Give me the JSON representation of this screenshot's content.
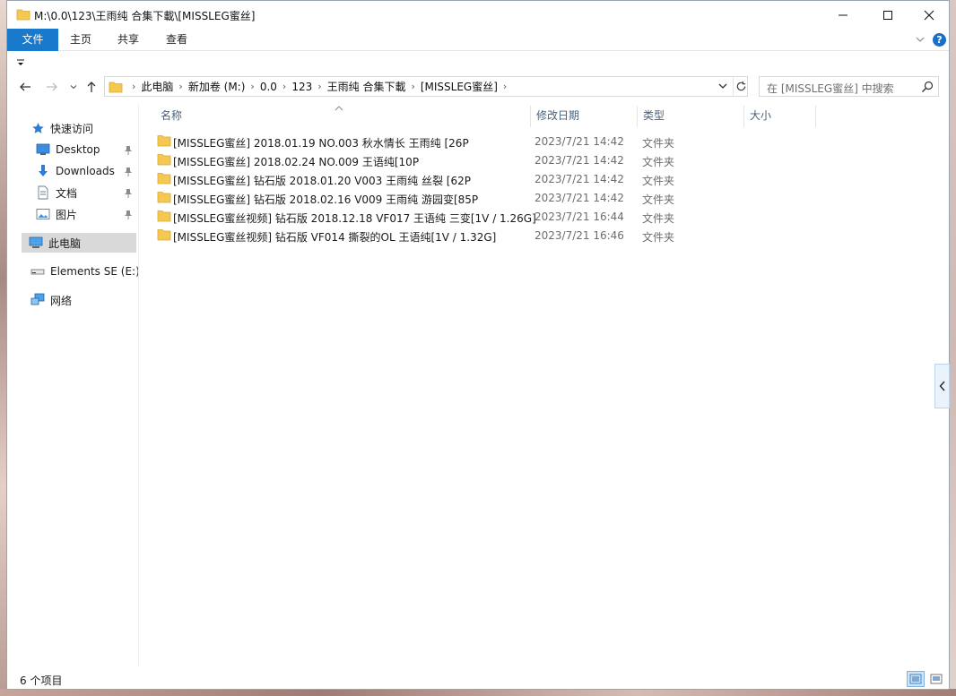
{
  "window": {
    "title": "M:\\0.0\\123\\王雨纯 合集下載\\[MISSLEG蜜丝]"
  },
  "ribbon": {
    "tabs": [
      {
        "label": "文件"
      },
      {
        "label": "主页"
      },
      {
        "label": "共享"
      },
      {
        "label": "查看"
      }
    ],
    "help_label": "?"
  },
  "address": {
    "crumbs": [
      "此电脑",
      "新加卷 (M:)",
      "0.0",
      "123",
      "王雨纯 合集下載",
      "[MISSLEG蜜丝]"
    ]
  },
  "search": {
    "placeholder": "在 [MISSLEG蜜丝] 中搜索"
  },
  "nav": {
    "quick_access": "快速访问",
    "items": [
      {
        "label": "Desktop"
      },
      {
        "label": "Downloads"
      },
      {
        "label": "文档"
      },
      {
        "label": "图片"
      }
    ],
    "this_pc": "此电脑",
    "drive": "Elements SE (E:)",
    "network": "网络"
  },
  "columns": {
    "name": "名称",
    "date": "修改日期",
    "type": "类型",
    "size": "大小"
  },
  "files": [
    {
      "name": "[MISSLEG蜜丝] 2018.01.19 NO.003 秋水情长 王雨纯 [26P",
      "date": "2023/7/21 14:42",
      "type": "文件夹"
    },
    {
      "name": "[MISSLEG蜜丝] 2018.02.24 NO.009 王语纯[10P",
      "date": "2023/7/21 14:42",
      "type": "文件夹"
    },
    {
      "name": "[MISSLEG蜜丝] 钻石版 2018.01.20 V003 王雨纯 丝裂  [62P",
      "date": "2023/7/21 14:42",
      "type": "文件夹"
    },
    {
      "name": "[MISSLEG蜜丝] 钻石版 2018.02.16 V009 王雨纯 游园变[85P",
      "date": "2023/7/21 14:42",
      "type": "文件夹"
    },
    {
      "name": "[MISSLEG蜜丝视频] 钻石版 2018.12.18 VF017 王语纯 三变[1V / 1.26G]",
      "date": "2023/7/21 16:44",
      "type": "文件夹"
    },
    {
      "name": "[MISSLEG蜜丝视频] 钻石版 VF014 撕裂的OL 王语纯[1V / 1.32G]",
      "date": "2023/7/21 16:46",
      "type": "文件夹"
    }
  ],
  "status": {
    "count": "6 个项目"
  },
  "colors": {
    "accent": "#1979ca",
    "folder": "#f5c851",
    "selected": "#d9d9d9"
  }
}
